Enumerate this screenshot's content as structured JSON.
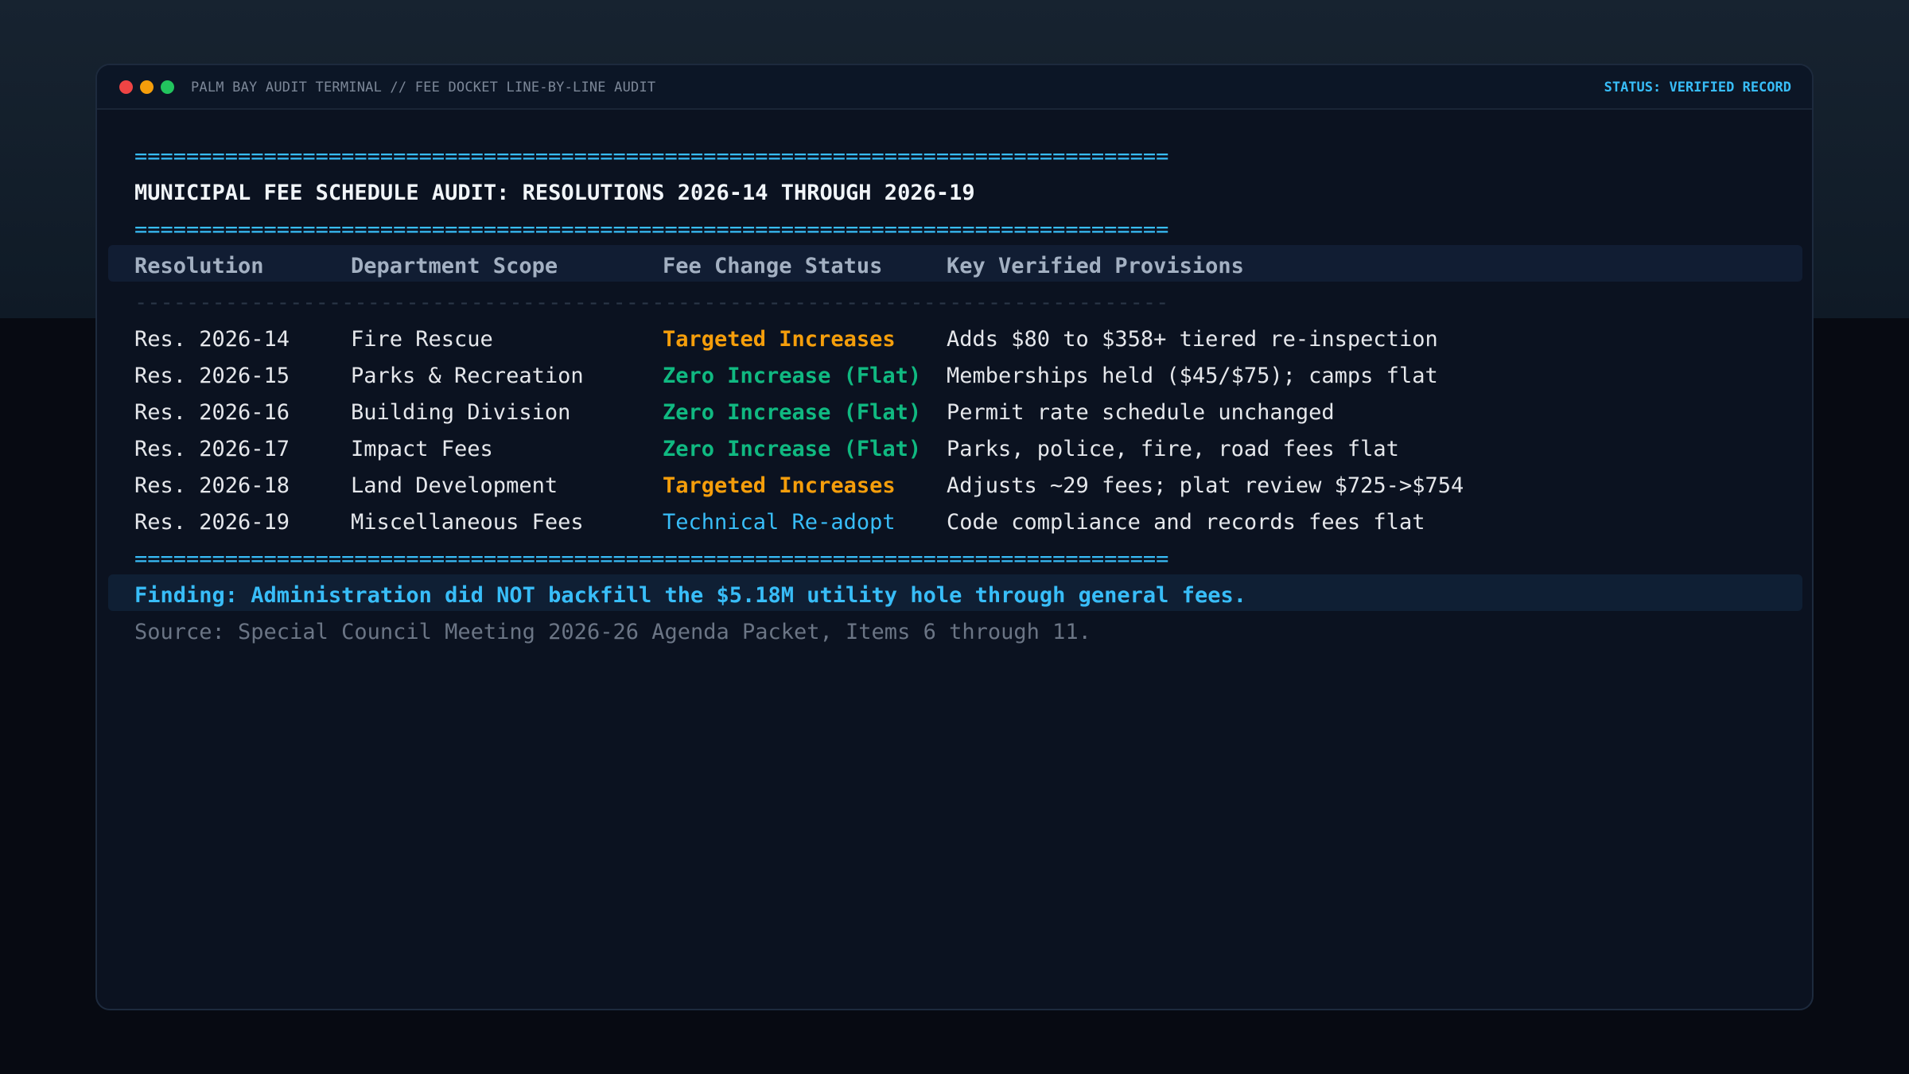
{
  "window": {
    "title": "PALM BAY AUDIT TERMINAL // FEE DOCKET LINE-BY-LINE AUDIT",
    "status": "STATUS: VERIFIED RECORD"
  },
  "terminal": {
    "rule_eq": "================================================================================",
    "rule_dash": "--------------------------------------------------------------------------------",
    "heading": "MUNICIPAL FEE SCHEDULE AUDIT: RESOLUTIONS 2026-14 THROUGH 2026-19",
    "columns": [
      "Resolution",
      "Department Scope",
      "Fee Change Status",
      "Key Verified Provisions"
    ],
    "rows": [
      {
        "resolution": "Res. 2026-14",
        "scope": "Fire Rescue",
        "status": "Targeted Increases",
        "status_kind": "increase",
        "provisions": "Adds $80 to $358+ tiered re-inspection"
      },
      {
        "resolution": "Res. 2026-15",
        "scope": "Parks & Recreation",
        "status": "Zero Increase (Flat)",
        "status_kind": "flat",
        "provisions": "Memberships held ($45/$75); camps flat"
      },
      {
        "resolution": "Res. 2026-16",
        "scope": "Building Division",
        "status": "Zero Increase (Flat)",
        "status_kind": "flat",
        "provisions": "Permit rate schedule unchanged"
      },
      {
        "resolution": "Res. 2026-17",
        "scope": "Impact Fees",
        "status": "Zero Increase (Flat)",
        "status_kind": "flat",
        "provisions": "Parks, police, fire, road fees flat"
      },
      {
        "resolution": "Res. 2026-18",
        "scope": "Land Development",
        "status": "Targeted Increases",
        "status_kind": "increase",
        "provisions": "Adjusts ~29 fees; plat review $725->$754"
      },
      {
        "resolution": "Res. 2026-19",
        "scope": "Miscellaneous Fees",
        "status": "Technical Re-adopt",
        "status_kind": "readopt",
        "provisions": "Code compliance and records fees flat"
      }
    ],
    "finding": "Finding: Administration did NOT backfill the $5.18M utility hole through general fees.",
    "source": "Source: Special Council Meeting 2026-26 Agenda Packet, Items 6 through 11."
  },
  "colors": {
    "accent_blue": "#38bdf8",
    "increase_orange": "#f59e0b",
    "flat_green": "#10b981",
    "window_bg": "#0b1220"
  }
}
